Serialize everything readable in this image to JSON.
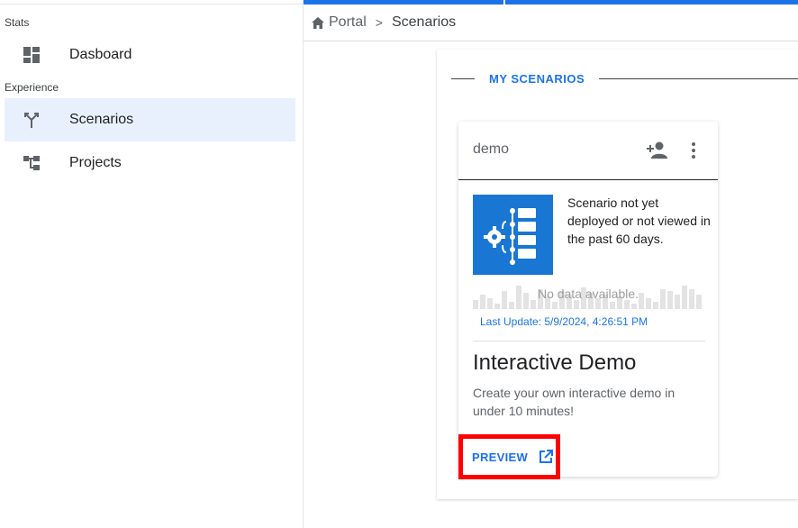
{
  "sidebar": {
    "sections": [
      {
        "label": "Stats"
      },
      {
        "label": "Experience"
      }
    ],
    "items": [
      {
        "label": "Dasboard",
        "icon": "dashboard-icon"
      },
      {
        "label": "Scenarios",
        "icon": "scenario-fork-icon",
        "active": true
      },
      {
        "label": "Projects",
        "icon": "tree-icon"
      }
    ]
  },
  "breadcrumb": {
    "home_label": "Portal",
    "separator": ">",
    "current": "Scenarios"
  },
  "panel": {
    "title": "MY SCENARIOS"
  },
  "card": {
    "name": "demo",
    "status_text": "Scenario not yet deployed or not viewed in the past 60 days.",
    "no_data": "No data available.",
    "last_update": "Last Update: 5/9/2024, 4:26:51 PM",
    "title": "Interactive Demo",
    "description": "Create your own interactive demo in under 10 minutes!",
    "preview_label": "PREVIEW"
  },
  "colors": {
    "accent": "#1a73e8",
    "thumbnail": "#1976d2",
    "highlight_box": "#ff0000",
    "active_nav": "#e8f0fe"
  }
}
